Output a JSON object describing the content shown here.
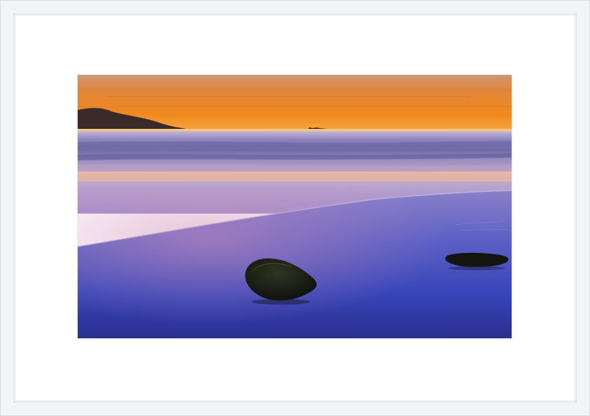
{
  "artwork": {
    "subject": "sunset-seascape",
    "elements": [
      "sky",
      "headland",
      "islet",
      "ocean-waves",
      "wet-sand-reflection",
      "rock-large",
      "rock-small"
    ],
    "colors": {
      "sky_top": "#c9a07a",
      "sky_glow": "#f28a1a",
      "horizon": "#f5b24a",
      "sea": "#8f86c4",
      "sand_pink": "#c8a2c8",
      "reflection_deep": "#2a3aa8",
      "frame": "#f3f4f6",
      "mat": "#ffffff"
    }
  }
}
